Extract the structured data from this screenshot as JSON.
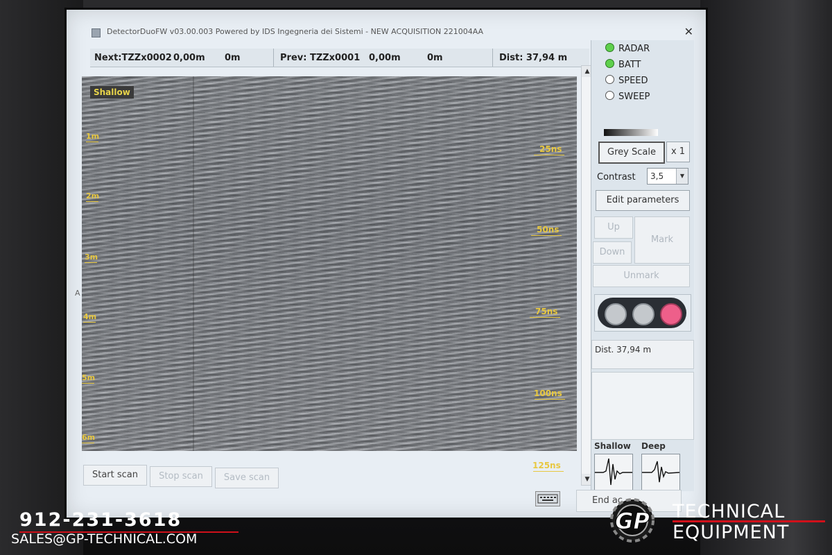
{
  "window": {
    "title": "DetectorDuoFW v03.00.003 Powered by IDS Ingegneria dei Sistemi - NEW ACQUISITION  221004AA",
    "close_glyph": "✕"
  },
  "infobar": {
    "next_label": "Next:TZZx0002",
    "next_pos": "0,00m",
    "next_dist": "0m",
    "prev_label": "Prev: TZZx0001",
    "prev_pos": "0,00m",
    "prev_dist": "0m",
    "dist_label": "Dist: 37,94 m"
  },
  "radar_view": {
    "mode_tag": "Shallow",
    "depth_labels": [
      "1m",
      "2m",
      "3m",
      "4m",
      "5m",
      "6m"
    ],
    "time_labels": [
      "25ns",
      "50ns",
      "75ns",
      "100ns",
      "125ns"
    ],
    "side_marker": "A"
  },
  "scrollbar": {
    "up_glyph": "▲",
    "down_glyph": "▼"
  },
  "scan_buttons": {
    "start": "Start scan",
    "stop": "Stop scan",
    "save": "Save scan"
  },
  "indicators": [
    {
      "label": "RADAR",
      "on": true
    },
    {
      "label": "BATT",
      "on": true
    },
    {
      "label": "SPEED",
      "on": false
    },
    {
      "label": "SWEEP",
      "on": false
    }
  ],
  "display": {
    "palette_button": "Grey Scale",
    "zoom_button": "x 1",
    "contrast_label": "Contrast",
    "contrast_value": "3,5",
    "edit_parameters": "Edit parameters"
  },
  "marks": {
    "up": "Up",
    "down": "Down",
    "mark": "Mark",
    "unmark": "Unmark"
  },
  "status": {
    "distance": "Dist. 37,94 m"
  },
  "waveforms": {
    "shallow": "Shallow",
    "deep": "Deep"
  },
  "footer": {
    "end_acquisition": "End ac"
  },
  "overlay": {
    "phone": "912-231-3618",
    "email": "SALES@GP-TECHNICAL.COM",
    "brand_mark": "GP",
    "brand_line1": "TECHNICAL",
    "brand_line2": "EQUIPMENT",
    "accent_color": "#d0101a"
  }
}
